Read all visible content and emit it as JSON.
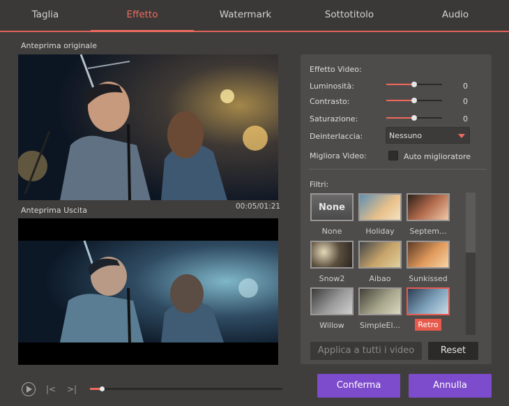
{
  "tabs": [
    {
      "label": "Taglia",
      "active": false
    },
    {
      "label": "Effetto",
      "active": true
    },
    {
      "label": "Watermark",
      "active": false
    },
    {
      "label": "Sottotitolo",
      "active": false
    },
    {
      "label": "Audio",
      "active": false
    }
  ],
  "preview": {
    "original_label": "Anteprima originale",
    "output_label": "Anteprima Uscita",
    "time": "00:05/01:21"
  },
  "effects": {
    "section_title": "Effetto Video:",
    "brightness": {
      "label": "Luminosità:",
      "value": "0"
    },
    "contrast": {
      "label": "Contrasto:",
      "value": "0"
    },
    "saturation": {
      "label": "Saturazione:",
      "value": "0"
    },
    "deinterlace": {
      "label": "Deinterlaccia:",
      "selected": "Nessuno"
    },
    "enhance": {
      "label": "Migliora Video:",
      "checkbox_label": "Auto miglioratore",
      "checked": false
    }
  },
  "filters": {
    "title": "Filtri:",
    "items": [
      {
        "name": "None",
        "thumb_text": "None"
      },
      {
        "name": "Holiday"
      },
      {
        "name": "Septem..."
      },
      {
        "name": "Snow2"
      },
      {
        "name": "Aibao"
      },
      {
        "name": "Sunkissed"
      },
      {
        "name": "Willow"
      },
      {
        "name": "SimpleEl..."
      },
      {
        "name": "Retro",
        "selected": true
      }
    ]
  },
  "buttons": {
    "apply_all": "Applica a tutti i video",
    "reset": "Reset",
    "confirm": "Conferma",
    "cancel": "Annulla"
  },
  "player": {
    "progress": 0.06
  },
  "colors": {
    "accent": "#f06b5e",
    "primary_button": "#7d4ccc",
    "background": "#403e3d"
  }
}
